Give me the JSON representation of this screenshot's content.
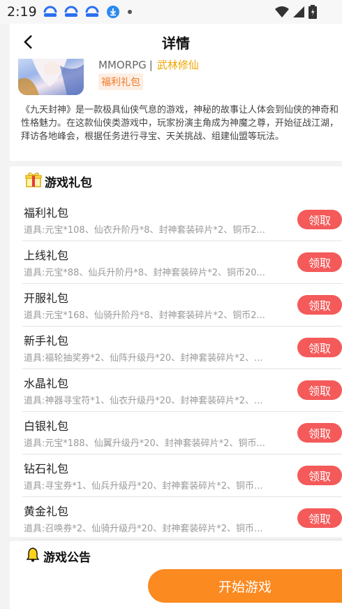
{
  "status_bar": {
    "time": "2:19"
  },
  "header": {
    "title": "详情"
  },
  "game": {
    "genre": "MMORPG",
    "separator": "|",
    "tag": "武林修仙",
    "badge": "福利礼包",
    "description": "《九天封神》是一款极具仙侠气息的游戏，神秘的故事让人体会到仙侠的神奇和性格魅力。在这款仙侠类游戏中，玩家扮演主角成为神魔之尊，开始征战江湖，拜访各地峰会，根据任务进行寻宝、天关挑战、组建仙盟等玩法。"
  },
  "gifts_section": {
    "title": "游戏礼包"
  },
  "gifts": [
    {
      "name": "福利礼包",
      "items": "道具:元宝*108、仙衣升阶丹*8、封神套装碎片*2、铜币2...",
      "action": "领取"
    },
    {
      "name": "上线礼包",
      "items": "道具:元宝*88、仙兵升阶丹*8、封神套装碎片*2、铜币20...",
      "action": "领取"
    },
    {
      "name": "开服礼包",
      "items": "道具:元宝*168、仙骑升阶丹*8、封神套装碎片*2、铜币2...",
      "action": "领取"
    },
    {
      "name": "新手礼包",
      "items": "道具:福轮抽奖券*2、仙阵升级丹*20、封神套装碎片*2、...",
      "action": "领取"
    },
    {
      "name": "水晶礼包",
      "items": "道具:神器寻宝符*1、仙衣升级丹*20、封神套装碎片*2、...",
      "action": "领取"
    },
    {
      "name": "白银礼包",
      "items": "道具:元宝*188、仙翼升级丹*20、封神套装碎片*2、铜币...",
      "action": "领取"
    },
    {
      "name": "钻石礼包",
      "items": "道具:寻宝券*1、仙兵升级丹*20、封神套装碎片*2、铜币...",
      "action": "领取"
    },
    {
      "name": "黄金礼包",
      "items": "道具:召唤券*2、仙骑升级丹*20、封神套装碎片*2、铜币...",
      "action": "领取"
    }
  ],
  "notice_section": {
    "title": "游戏公告"
  },
  "start_button": {
    "label": "开始游戏"
  },
  "colors": {
    "claim": "#f45a5a",
    "start": "#fb8a20",
    "badge_text": "#f07c2a",
    "tag": "#f0a500"
  }
}
